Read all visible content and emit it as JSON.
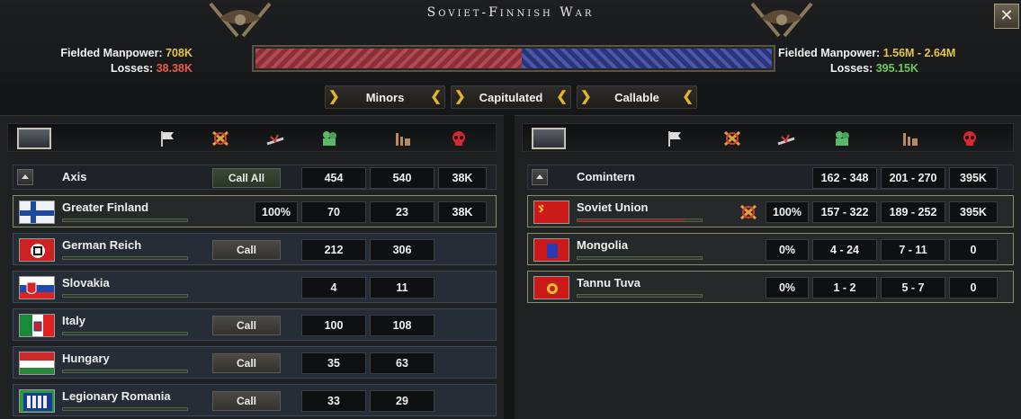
{
  "window": {
    "title": "Soviet-Finnish War",
    "close_label": "✕"
  },
  "left_side": {
    "manpower_label": "Fielded Manpower:",
    "manpower_value": "708K",
    "losses_label": "Losses:",
    "losses_value": "38.38K"
  },
  "right_side": {
    "manpower_label": "Fielded Manpower:",
    "manpower_value": "1.56M - 2.64M",
    "losses_label": "Losses:",
    "losses_value": "395.15K"
  },
  "war_progress": 0.515,
  "colors": {
    "axis": "#b24a54",
    "comintern": "#4b57a8",
    "gold": "#e2c64a"
  },
  "tabs": [
    {
      "label": "Minors"
    },
    {
      "label": "Capitulated"
    },
    {
      "label": "Callable"
    }
  ],
  "column_icons": [
    "white-flag-icon",
    "fighting-swords-icon",
    "fallen-soldier-icon",
    "troops-icon",
    "factory-icon",
    "skull-icon"
  ],
  "axis": {
    "faction": {
      "name": "Axis",
      "call_all": "Call All",
      "c1": "454",
      "c2": "540",
      "c3": "38K"
    },
    "rows": [
      {
        "name": "Greater Finland",
        "percent": "100%",
        "c1": "70",
        "c2": "23",
        "c3": "38K",
        "manpower_fill": 0.0
      },
      {
        "name": "German Reich",
        "call": "Call",
        "c1": "212",
        "c2": "306",
        "manpower_fill": 0.0
      },
      {
        "name": "Slovakia",
        "c1": "4",
        "c2": "11",
        "manpower_fill": 0.0
      },
      {
        "name": "Italy",
        "call": "Call",
        "c1": "100",
        "c2": "108",
        "manpower_fill": 0.0
      },
      {
        "name": "Hungary",
        "call": "Call",
        "c1": "35",
        "c2": "63",
        "manpower_fill": 0.0
      },
      {
        "name": "Legionary Romania",
        "call": "Call",
        "c1": "33",
        "c2": "29",
        "manpower_fill": 0.0
      }
    ]
  },
  "comintern": {
    "faction": {
      "name": "Comintern",
      "c1": "162 - 348",
      "c2": "201 - 270",
      "c3": "395K"
    },
    "rows": [
      {
        "name": "Soviet Union",
        "percent": "100%",
        "c1": "157 - 322",
        "c2": "189 - 252",
        "c3": "395K",
        "manpower_fill": 0.86
      },
      {
        "name": "Mongolia",
        "percent": "0%",
        "c1": "4 - 24",
        "c2": "7 - 11",
        "c3": "0",
        "manpower_fill": 0.0
      },
      {
        "name": "Tannu Tuva",
        "percent": "0%",
        "c1": "1 - 2",
        "c2": "5 - 7",
        "c3": "0",
        "manpower_fill": 0.0
      }
    ]
  }
}
